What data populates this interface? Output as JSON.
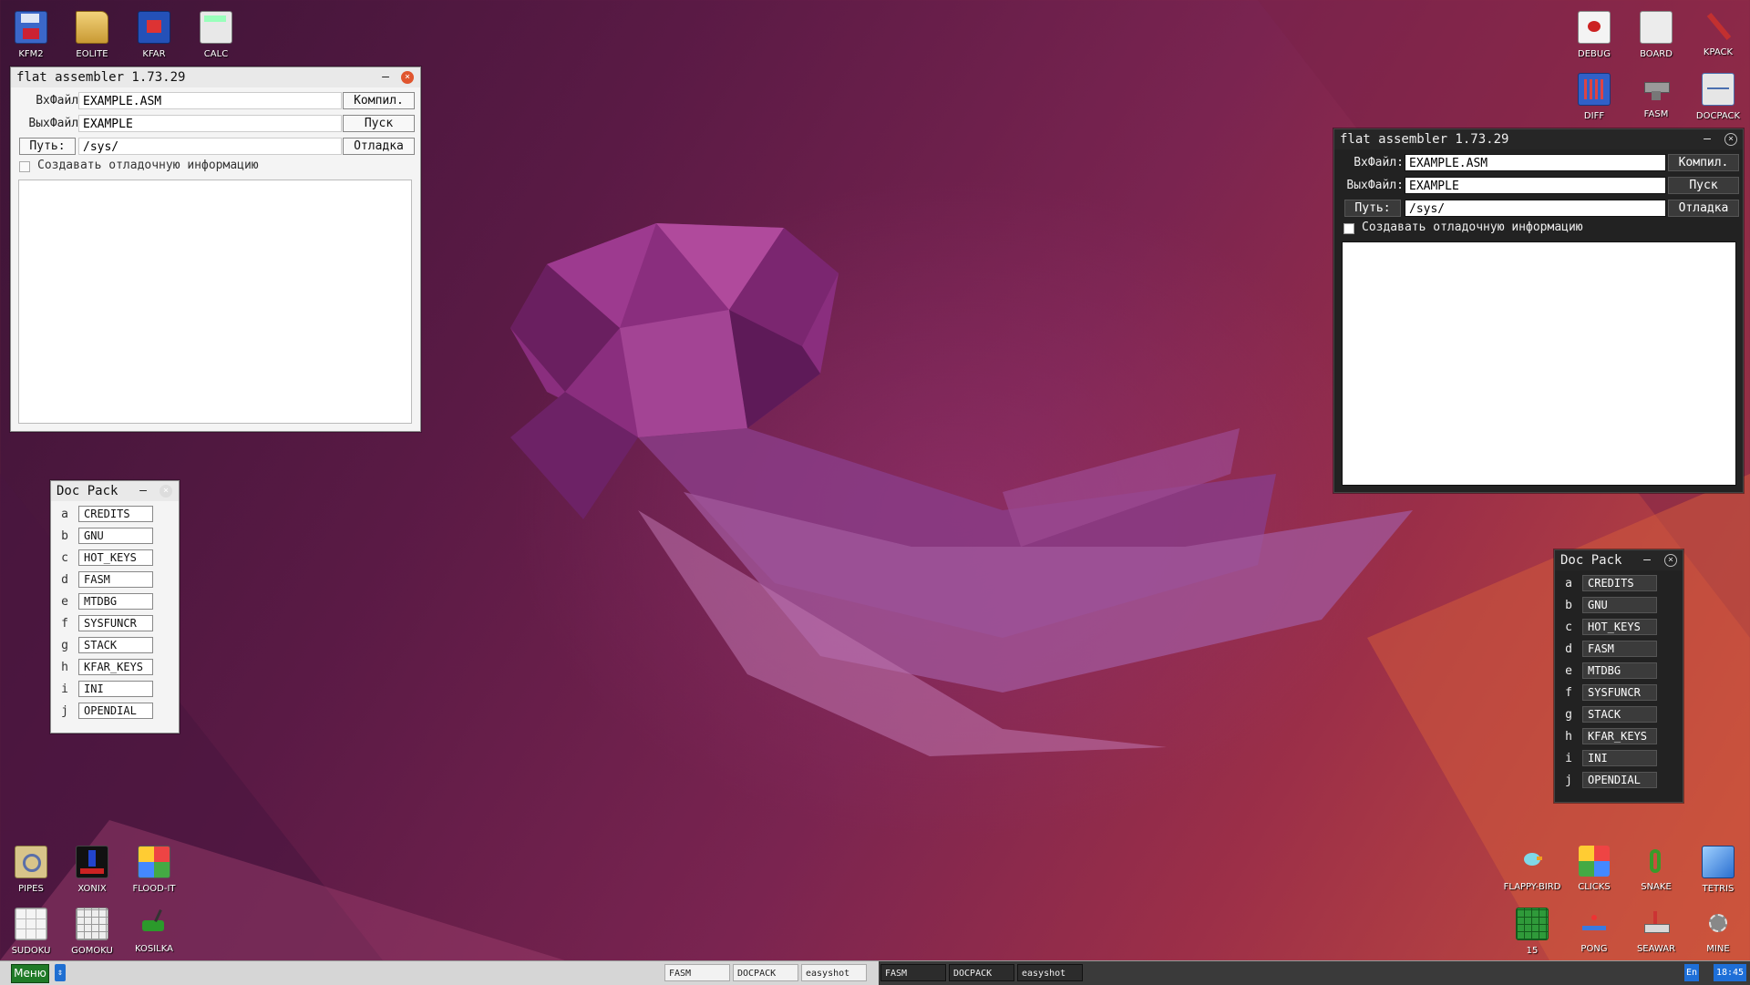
{
  "desktop": {
    "icons_top_left": [
      {
        "label": "KFM2",
        "icon": "floppy-disk-icon"
      },
      {
        "label": "EOLITE",
        "icon": "folder-icon"
      },
      {
        "label": "KFAR",
        "icon": "archive-grid-icon"
      },
      {
        "label": "CALC",
        "icon": "calculator-icon"
      }
    ],
    "icons_top_right_row1": [
      {
        "label": "DEBUG",
        "icon": "debug-bug-icon"
      },
      {
        "label": "BOARD",
        "icon": "board-keyboard-icon"
      },
      {
        "label": "KPACK",
        "icon": "wrench-icon"
      }
    ],
    "icons_top_right_row2": [
      {
        "label": "DIFF",
        "icon": "diff-grid-icon"
      },
      {
        "label": "FASM",
        "icon": "anvil-icon"
      },
      {
        "label": "DOCPACK",
        "icon": "cabinet-icon"
      }
    ],
    "icons_bottom_left_row1": [
      {
        "label": "PIPES",
        "icon": "pipes-icon"
      },
      {
        "label": "XONIX",
        "icon": "xonix-icon"
      },
      {
        "label": "FLOOD-IT",
        "icon": "flood-it-icon"
      }
    ],
    "icons_bottom_left_row2": [
      {
        "label": "SUDOKU",
        "icon": "sudoku-icon"
      },
      {
        "label": "GOMOKU",
        "icon": "gomoku-icon"
      },
      {
        "label": "KOSILKA",
        "icon": "lawnmower-icon"
      }
    ],
    "icons_bottom_right_row1": [
      {
        "label": "FLAPPY-BIRD",
        "icon": "bird-icon"
      },
      {
        "label": "CLICKS",
        "icon": "clicks-blocks-icon"
      },
      {
        "label": "SNAKE",
        "icon": "snake-icon"
      },
      {
        "label": "TETRIS",
        "icon": "tetris-cube-icon"
      }
    ],
    "icons_bottom_right_row2": [
      {
        "label": "15",
        "icon": "fifteen-grid-icon"
      },
      {
        "label": "PONG",
        "icon": "pong-icon"
      },
      {
        "label": "SEAWAR",
        "icon": "ship-icon"
      },
      {
        "label": "MINE",
        "icon": "mine-icon"
      }
    ]
  },
  "fasm_light": {
    "title": "flat assembler 1.73.29",
    "minimize": "–",
    "close": "×",
    "in_label": "ВхФайл:",
    "in_value": "EXAMPLE.ASM",
    "out_label": "ВыхФайл:",
    "out_value": "EXAMPLE",
    "path_button": "Путь:",
    "path_value": "/sys/",
    "compile": "Компил.",
    "run": "Пуск",
    "debug": "Отладка",
    "debug_info": "Создавать отладочную информацию"
  },
  "fasm_dark": {
    "title": "flat assembler 1.73.29",
    "minimize": "–",
    "close": "×",
    "in_label": "ВхФайл:",
    "in_value": "EXAMPLE.ASM",
    "out_label": "ВыхФайл:",
    "out_value": "EXAMPLE",
    "path_button": "Путь:",
    "path_value": "/sys/",
    "compile": "Компил.",
    "run": "Пуск",
    "debug": "Отладка",
    "debug_info": "Создавать отладочную информацию"
  },
  "docpack_light": {
    "title": "Doc Pack",
    "minimize": "–",
    "close": "×",
    "items": [
      {
        "key": "a",
        "label": "CREDITS"
      },
      {
        "key": "b",
        "label": "GNU"
      },
      {
        "key": "c",
        "label": "HOT_KEYS"
      },
      {
        "key": "d",
        "label": "FASM"
      },
      {
        "key": "e",
        "label": "MTDBG"
      },
      {
        "key": "f",
        "label": "SYSFUNCR"
      },
      {
        "key": "g",
        "label": "STACK"
      },
      {
        "key": "h",
        "label": "KFAR_KEYS"
      },
      {
        "key": "i",
        "label": "INI"
      },
      {
        "key": "j",
        "label": "OPENDIAL"
      }
    ]
  },
  "docpack_dark": {
    "title": "Doc Pack",
    "minimize": "–",
    "close": "×",
    "items": [
      {
        "key": "a",
        "label": "CREDITS"
      },
      {
        "key": "b",
        "label": "GNU"
      },
      {
        "key": "c",
        "label": "HOT_KEYS"
      },
      {
        "key": "d",
        "label": "FASM"
      },
      {
        "key": "e",
        "label": "MTDBG"
      },
      {
        "key": "f",
        "label": "SYSFUNCR"
      },
      {
        "key": "g",
        "label": "STACK"
      },
      {
        "key": "h",
        "label": "KFAR_KEYS"
      },
      {
        "key": "i",
        "label": "INI"
      },
      {
        "key": "j",
        "label": "OPENDIAL"
      }
    ]
  },
  "taskbar": {
    "menu": "Меню",
    "arrows": "⇕",
    "tasks_light": [
      "FASM",
      "DOCPACK",
      "easyshot"
    ],
    "tasks_dark": [
      "FASM",
      "DOCPACK",
      "easyshot"
    ],
    "lang": "En",
    "clock": "18:45"
  },
  "colors": {
    "menu_green": "#1f7a27",
    "clock_blue": "#1e6fd8",
    "close_orange": "#e0552e"
  }
}
